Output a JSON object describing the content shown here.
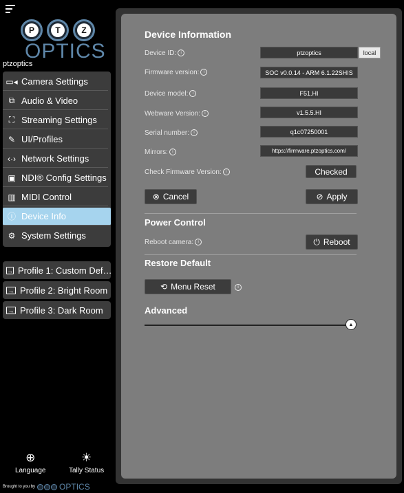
{
  "app": {
    "device_name": "ptzoptics",
    "logo_letters": [
      "P",
      "T",
      "Z"
    ],
    "logo_word": "OPTICS"
  },
  "sidebar": {
    "items": [
      {
        "label": "Camera Settings",
        "icon": "camera-icon"
      },
      {
        "label": "Audio & Video",
        "icon": "audio-video-icon"
      },
      {
        "label": "Streaming Settings",
        "icon": "streaming-icon"
      },
      {
        "label": "UI/Profiles",
        "icon": "ui-profiles-icon"
      },
      {
        "label": "Network Settings",
        "icon": "network-icon"
      },
      {
        "label": "NDI® Config Settings",
        "icon": "ndi-icon"
      },
      {
        "label": "MIDI Control",
        "icon": "midi-icon"
      },
      {
        "label": "Device Info",
        "icon": "info-icon",
        "active": true
      },
      {
        "label": "System Settings",
        "icon": "gear-icon"
      }
    ],
    "profiles": [
      {
        "label": "Profile 1: Custom Def…"
      },
      {
        "label": "Profile 2: Bright Room"
      },
      {
        "label": "Profile 3: Dark Room"
      }
    ],
    "footer": {
      "language": "Language",
      "tally": "Tally Status",
      "credit": "Brought to you by",
      "credit_logo": "OPTICS"
    }
  },
  "device_info": {
    "title": "Device Information",
    "device_id": {
      "label": "Device ID:",
      "value": "ptzoptics",
      "tag": "local"
    },
    "firmware": {
      "label": "Firmware version:",
      "value": "SOC v0.0.14 - ARM 6.1.22SHIS"
    },
    "model": {
      "label": "Device model:",
      "value": "F51.HI"
    },
    "webware": {
      "label": "Webware Version:",
      "value": "v1.5.5.HI"
    },
    "serial": {
      "label": "Serial number:",
      "value": "q1c07250001"
    },
    "mirrors": {
      "label": "Mirrors:",
      "value": "https://firmware.ptzoptics.com/"
    },
    "check_fw": {
      "label": "Check Firmware Version:",
      "button": "Checked"
    },
    "cancel": "Cancel",
    "apply": "Apply"
  },
  "power": {
    "title": "Power Control",
    "reboot_label": "Reboot camera:",
    "reboot_button": "Reboot"
  },
  "restore": {
    "title": "Restore Default",
    "menu_reset": "Menu Reset"
  },
  "advanced": {
    "title": "Advanced"
  },
  "colors": {
    "active_nav": "#a6d4ee",
    "brand": "#5e86a8",
    "panel": "#7d7d7d"
  }
}
